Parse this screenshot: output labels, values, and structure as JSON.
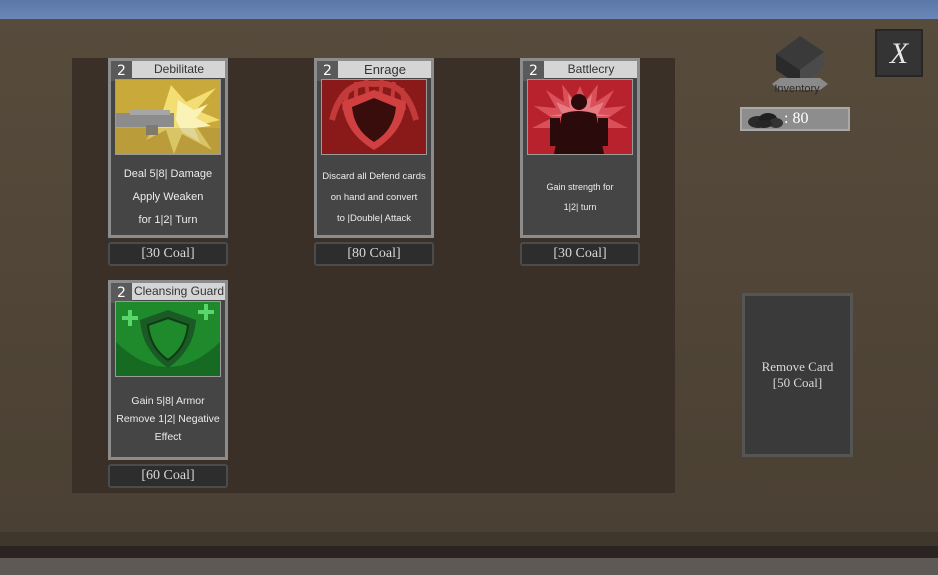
{
  "player": {
    "coal_label": ": 80",
    "inventory_label": "Inventory"
  },
  "cards": [
    {
      "name": "Debilitate",
      "cost": "2",
      "description": [
        "Deal 5|8| Damage",
        "Apply Weaken",
        "for 1|2| Turn"
      ],
      "price_label": "[30 Coal]",
      "art": "gun-blast-art",
      "art_color": "#c9a93a"
    },
    {
      "name": "Enrage",
      "cost": "2",
      "description": [
        "Discard all Defend cards",
        "on hand and convert",
        "to |Double| Attack"
      ],
      "price_label": "[80 Coal]",
      "art": "red-shield-art",
      "art_color": "#8a1a1a"
    },
    {
      "name": "Battlecry",
      "cost": "2",
      "description": [
        "Gain strength for",
        "1|2| turn"
      ],
      "price_label": "[30 Coal]",
      "art": "shadow-warrior-art",
      "art_color": "#b8222c"
    },
    {
      "name": "Cleansing Guard",
      "cost": "2",
      "description": [
        "Gain 5|8| Armor",
        "Remove 1|2| Negative",
        "Effect"
      ],
      "price_label": "[60 Coal]",
      "art": "green-shield-art",
      "art_color": "#1f8a2c"
    }
  ],
  "remove_card": {
    "line1": "Remove Card",
    "line2": "[50 Coal]"
  },
  "close_button": {
    "glyph": "X"
  }
}
